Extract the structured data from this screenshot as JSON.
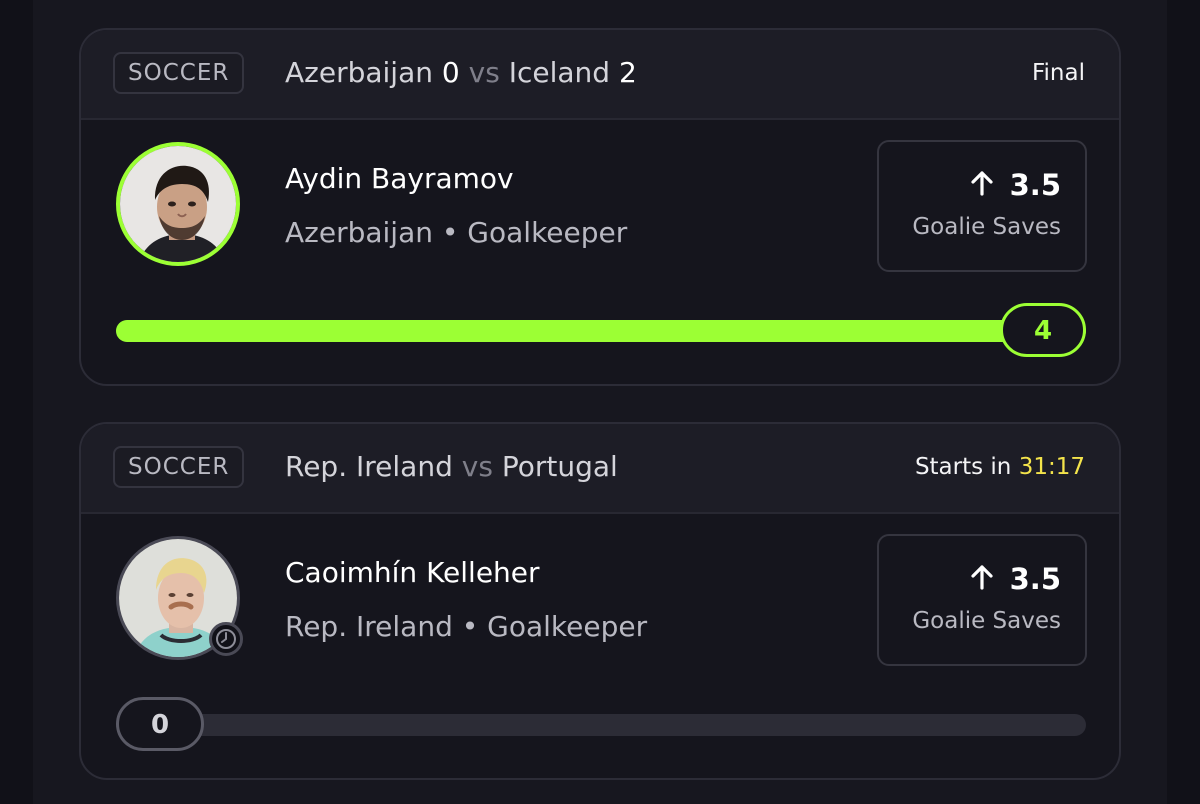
{
  "cards": [
    {
      "sport": "SOCCER",
      "home_team": "Azerbaijan",
      "home_score": "0",
      "vs": "vs",
      "away_team": "Iceland",
      "away_score": "2",
      "status": "Final",
      "player": {
        "name": "Aydin Bayramov",
        "meta": "Azerbaijan • Goalkeeper"
      },
      "line": "3.5",
      "direction_icon": "arrow-up-icon",
      "stat": "Goalie Saves",
      "current_value": "4",
      "progress_fraction": 1.0,
      "accent_color": "#9cff34"
    },
    {
      "sport": "SOCCER",
      "home_team": "Rep. Ireland",
      "vs": "vs",
      "away_team": "Portugal",
      "status_prefix": "Starts in",
      "countdown": "31:17",
      "status_icon": "clock-icon",
      "player": {
        "name": "Caoimhín Kelleher",
        "meta": "Rep. Ireland • Goalkeeper"
      },
      "line": "3.5",
      "direction_icon": "arrow-up-icon",
      "stat": "Goalie Saves",
      "current_value": "0",
      "progress_fraction": 0.0,
      "countdown_color": "#f4e44b"
    }
  ]
}
